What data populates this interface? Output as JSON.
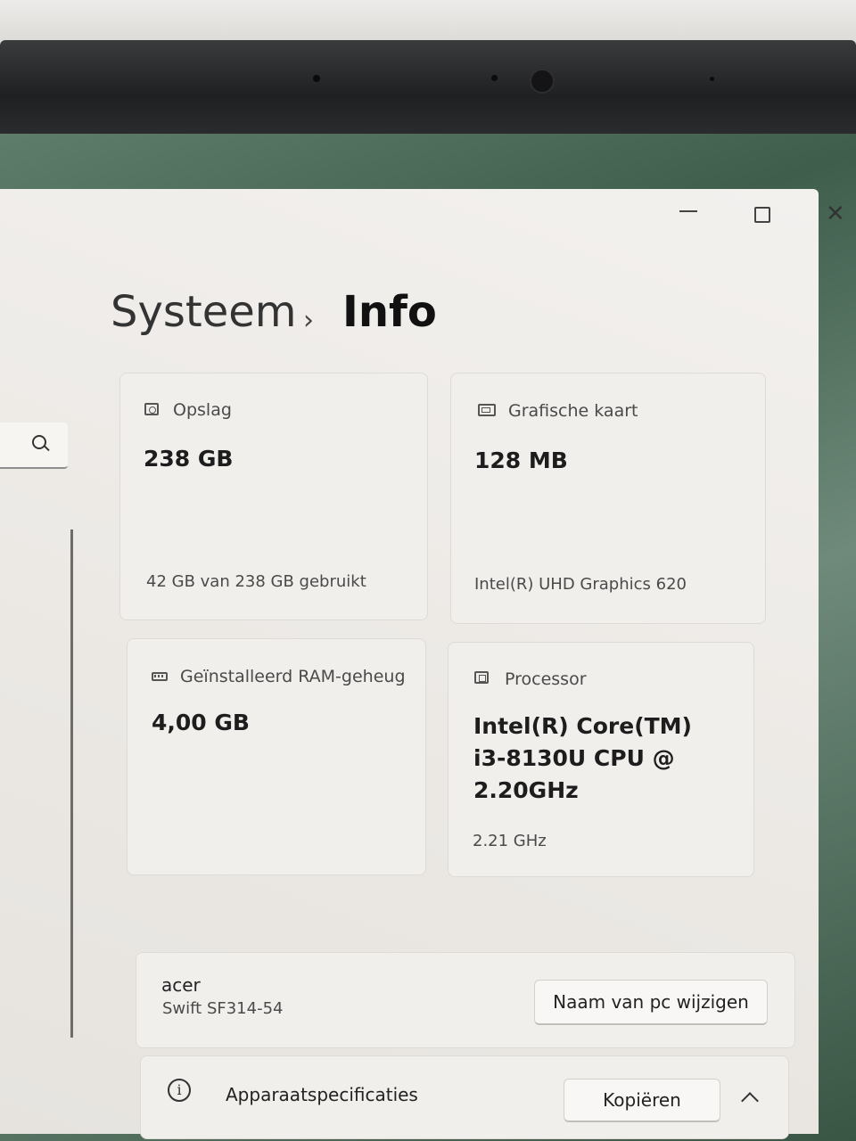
{
  "breadcrumb": {
    "parent": "Systeem",
    "separator": "›",
    "current": "Info"
  },
  "cards": {
    "storage": {
      "title": "Opslag",
      "value": "238 GB",
      "detail": "42 GB van 238 GB gebruikt",
      "icon": "drive-icon"
    },
    "graphics": {
      "title": "Grafische kaart",
      "value": "128 MB",
      "detail": "Intel(R) UHD Graphics 620",
      "icon": "display-icon"
    },
    "ram": {
      "title": "Geïnstalleerd RAM-geheug",
      "value": "4,00 GB",
      "icon": "memory-icon"
    },
    "processor": {
      "title": "Processor",
      "value_lines": [
        "Intel(R) Core(TM)",
        "i3-8130U CPU @",
        "2.20GHz"
      ],
      "detail": "2.21 GHz",
      "icon": "cpu-icon"
    }
  },
  "device": {
    "brand": "acer",
    "model": "Swift SF314-54",
    "rename_button": "Naam van pc wijzigen"
  },
  "specs": {
    "label": "Apparaatspecificaties",
    "copy_button": "Kopiëren"
  },
  "window_controls": {
    "close": "✕"
  },
  "icons": [
    "search-icon",
    "minimize-icon",
    "maximize-icon",
    "close-icon",
    "info-icon",
    "chevron-up-icon"
  ]
}
